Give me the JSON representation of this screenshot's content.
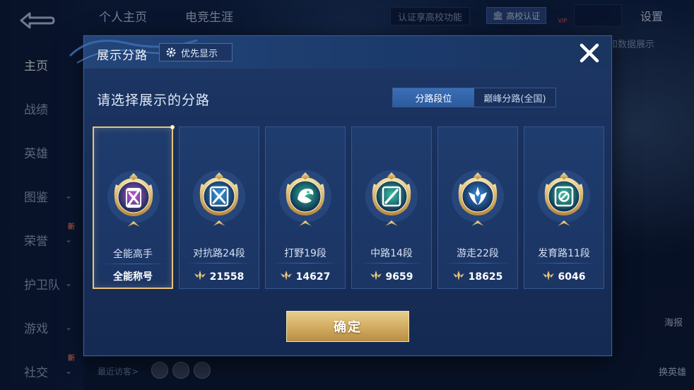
{
  "background": {
    "sidebar": [
      {
        "label": "主页",
        "active": true,
        "chevron": false,
        "badge": ""
      },
      {
        "label": "战绩",
        "active": false,
        "chevron": false,
        "badge": ""
      },
      {
        "label": "英雄",
        "active": false,
        "chevron": false,
        "badge": ""
      },
      {
        "label": "图鉴",
        "active": false,
        "chevron": true,
        "badge": ""
      },
      {
        "label": "荣誉",
        "active": false,
        "chevron": true,
        "badge": "新"
      },
      {
        "label": "护卫队",
        "active": false,
        "chevron": true,
        "badge": ""
      },
      {
        "label": "游戏",
        "active": false,
        "chevron": true,
        "badge": ""
      },
      {
        "label": "社交",
        "active": false,
        "chevron": true,
        "badge": "新"
      }
    ],
    "top_tabs": [
      "个人主页",
      "电竞生涯"
    ],
    "cert_hint": "认证享高校功能",
    "school_cert": "高校认证",
    "vip": "VIP",
    "settings": "设置",
    "right_hint": "案和数据展示",
    "visitors_label": "最近访客>",
    "right_labels": [
      "海报",
      "换英雄"
    ]
  },
  "modal": {
    "title": "展示分路",
    "priority_label": "优先显示",
    "subtitle": "请选择展示的分路",
    "tabs": [
      {
        "label": "分路段位",
        "active": true
      },
      {
        "label": "巅峰分路(全国)",
        "active": false
      }
    ],
    "cards": [
      {
        "name": "全能高手",
        "foot": "全能称号",
        "selected": true,
        "emblem": "all-rounder-emblem",
        "color": "#c45ad8"
      },
      {
        "name": "对抗路24段",
        "foot": "21558",
        "selected": false,
        "emblem": "clash-lane-emblem",
        "color": "#3b9ee8"
      },
      {
        "name": "打野19段",
        "foot": "14627",
        "selected": false,
        "emblem": "jungle-emblem",
        "color": "#2fbf9a"
      },
      {
        "name": "中路14段",
        "foot": "9659",
        "selected": false,
        "emblem": "mid-lane-emblem",
        "color": "#36c4a6"
      },
      {
        "name": "游走22段",
        "foot": "18625",
        "selected": false,
        "emblem": "roam-emblem",
        "color": "#3a8be0"
      },
      {
        "name": "发育路11段",
        "foot": "6046",
        "selected": false,
        "emblem": "farm-lane-emblem",
        "color": "#3cc7a0"
      }
    ],
    "confirm_label": "确定"
  },
  "colors": {
    "gold": "#e6c37c",
    "panel": "#1b3564",
    "active_tab": "#2c5a9e"
  }
}
